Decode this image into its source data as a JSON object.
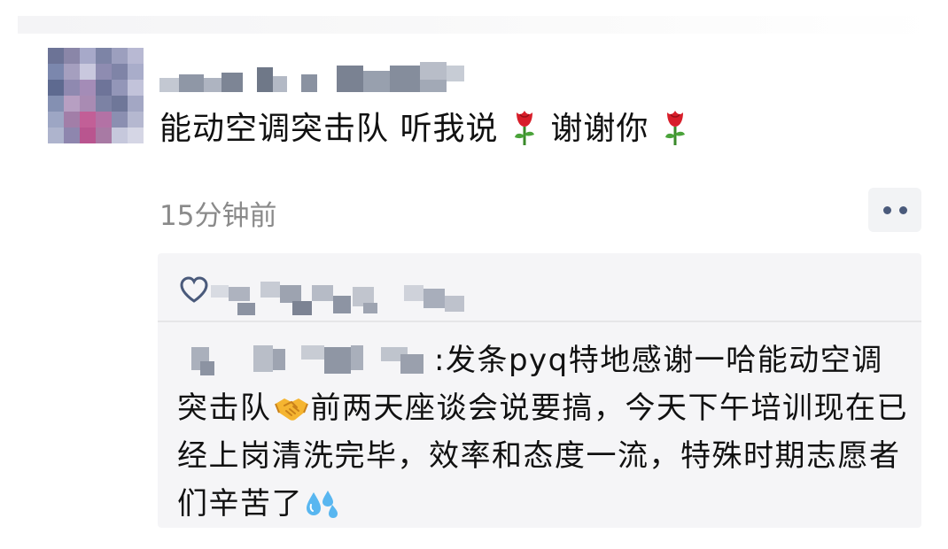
{
  "post": {
    "text_part1": "能动空调突击队 听我说",
    "text_part2": "谢谢你",
    "timestamp": "15分钟前"
  },
  "icons": {
    "inline_1": "rose-icon",
    "inline_2": "rose-icon",
    "more": "more-dots-icon",
    "like": "heart-icon",
    "comment_1": "handshake-icon",
    "comment_2": "sweat-droplets-icon"
  },
  "comment": {
    "separator": ":",
    "text_part1": "发条pyq特地感谢一哈能动空调突击队",
    "text_part2": "前两天座谈会说要搞，今天下午培训现在已经上岗清洗完毕，效率和态度一流，特殊时期志愿者们辛苦了"
  },
  "colors": {
    "text": "#111111",
    "timestamp": "#8a8a8a",
    "comment_bg": "#f5f5f7",
    "more_dots": "#4a5a7b"
  }
}
